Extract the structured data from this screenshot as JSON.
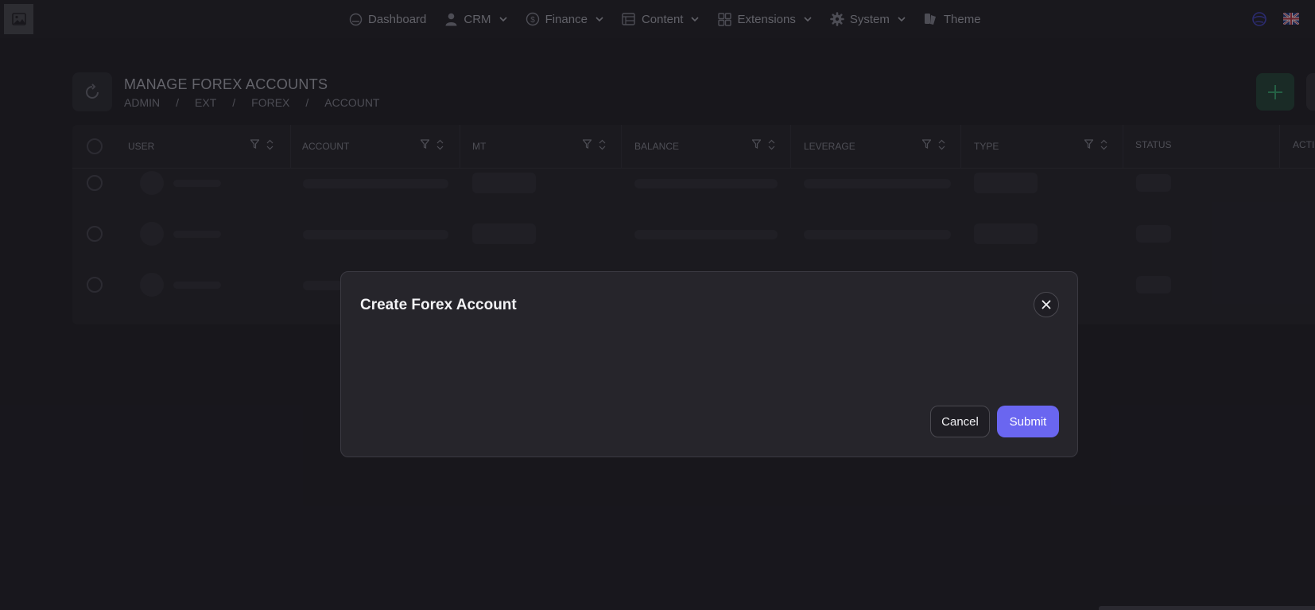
{
  "nav": {
    "items": [
      {
        "label": "Dashboard",
        "icon": "dashboard-icon",
        "has_dropdown": false
      },
      {
        "label": "CRM",
        "icon": "user-icon",
        "has_dropdown": true
      },
      {
        "label": "Finance",
        "icon": "dollar-circle-icon",
        "has_dropdown": true
      },
      {
        "label": "Content",
        "icon": "content-table-icon",
        "has_dropdown": true
      },
      {
        "label": "Extensions",
        "icon": "grid-icon",
        "has_dropdown": true
      },
      {
        "label": "System",
        "icon": "gear-icon",
        "has_dropdown": true
      },
      {
        "label": "Theme",
        "icon": "theme-icon",
        "has_dropdown": false
      }
    ]
  },
  "page": {
    "title": "MANAGE FOREX ACCOUNTS",
    "breadcrumb": [
      "ADMIN",
      "/",
      "EXT",
      "/",
      "FOREX",
      "/",
      "ACCOUNT"
    ]
  },
  "table": {
    "columns": [
      "USER",
      "ACCOUNT",
      "MT",
      "BALANCE",
      "LEVERAGE",
      "TYPE",
      "STATUS",
      "ACTIO"
    ]
  },
  "modal": {
    "title": "Create Forex Account",
    "cancel_label": "Cancel",
    "submit_label": "Submit"
  },
  "colors": {
    "accent": "#6a66f0",
    "background": "#1c1b21",
    "modal_bg": "#26252b"
  }
}
